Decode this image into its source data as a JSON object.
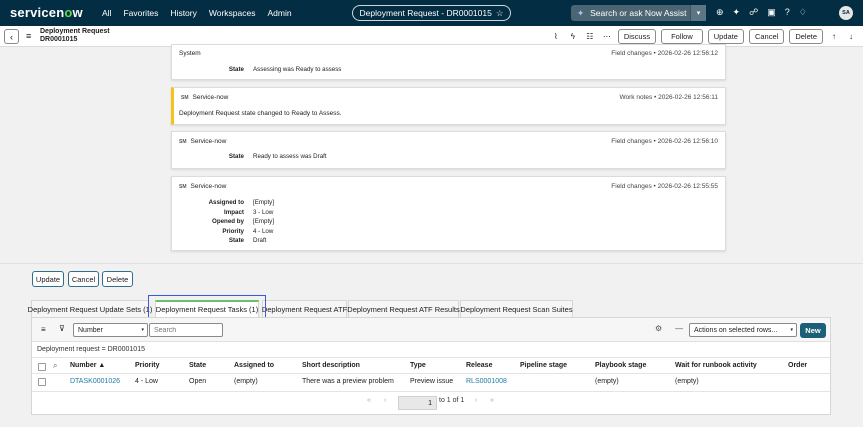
{
  "topnav": {
    "logo_prefix": "servicen",
    "logo_o": "o",
    "logo_suffix": "w",
    "items": [
      "All",
      "Favorites",
      "History",
      "Workspaces",
      "Admin"
    ],
    "record_pill": "Deployment Request - DR0001015",
    "search_label": "Search or ask Now Assist",
    "avatar_initials": "SA"
  },
  "header": {
    "title_line1": "Deployment Request",
    "title_line2": "DR0001015",
    "discuss": "Discuss",
    "follow": "Follow",
    "update": "Update",
    "cancel": "Cancel",
    "delete": "Delete"
  },
  "activity": [
    {
      "author": "System",
      "meta": "Field changes • 2026-02-26 12:56:12",
      "fields": [
        {
          "label": "State",
          "value": "Assessing was Ready to assess"
        }
      ]
    },
    {
      "badge": "SM",
      "author": "Service-now",
      "meta": "Work notes • 2026-02-26 12:56:11",
      "text": "Deployment Request state changed to Ready to Assess."
    },
    {
      "badge": "SM",
      "author": "Service-now",
      "meta": "Field changes • 2026-02-26 12:56:10",
      "fields": [
        {
          "label": "State",
          "value": "Ready to assess was Draft"
        }
      ]
    },
    {
      "badge": "SM",
      "author": "Service-now",
      "meta": "Field changes • 2026-02-26 12:55:55",
      "fields": [
        {
          "label": "Assigned to",
          "value": "[Empty]"
        },
        {
          "label": "Impact",
          "value": "3 - Low"
        },
        {
          "label": "Opened by",
          "value": "[Empty]"
        },
        {
          "label": "Priority",
          "value": "4 - Low"
        },
        {
          "label": "State",
          "value": "Draft"
        }
      ]
    }
  ],
  "bottom_buttons": {
    "update": "Update",
    "cancel": "Cancel",
    "delete": "Delete"
  },
  "tabs": [
    "Deployment Request Update Sets (1)",
    "Deployment Request Tasks (1)",
    "Deployment Request ATF",
    "Deployment Request ATF Results",
    "Deployment Request Scan Suites"
  ],
  "list": {
    "field_select": "Number",
    "search_placeholder": "Search",
    "actions_select": "Actions on selected rows...",
    "new_label": "New",
    "breadcrumb": "Deployment request = DR0001015",
    "columns": [
      "Number ▲",
      "Priority",
      "State",
      "Assigned to",
      "Short description",
      "Type",
      "Release",
      "Pipeline stage",
      "Playbook stage",
      "Wait for runbook activity",
      "Order"
    ],
    "row": [
      "DTASK0001026",
      "4 - Low",
      "Open",
      "(empty)",
      "There was a preview problem",
      "Preview issue",
      "RLS0001008",
      "",
      "(empty)",
      "(empty)",
      ""
    ],
    "pager_page": "1",
    "pager_total": "to 1 of 1"
  },
  "colors": {
    "nav_bg": "#032d42",
    "accent_green": "#62d84e",
    "new_button": "#1e5f78",
    "link": "#1f7aa3",
    "highlight": "#3c5bd6"
  }
}
